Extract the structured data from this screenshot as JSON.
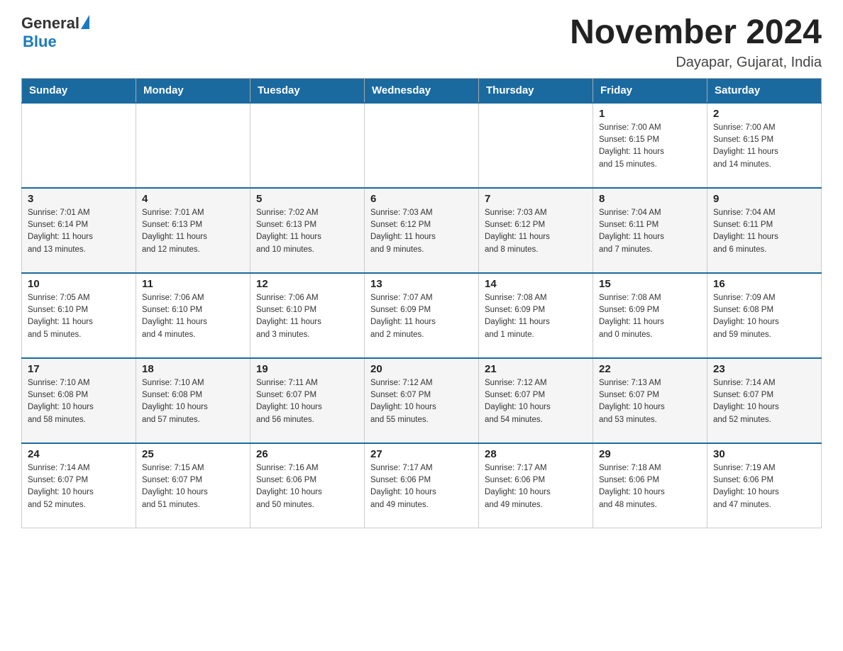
{
  "header": {
    "logo_general": "General",
    "logo_blue": "Blue",
    "month_title": "November 2024",
    "location": "Dayapar, Gujarat, India"
  },
  "weekdays": [
    "Sunday",
    "Monday",
    "Tuesday",
    "Wednesday",
    "Thursday",
    "Friday",
    "Saturday"
  ],
  "rows": [
    {
      "cells": [
        {
          "day": "",
          "info": ""
        },
        {
          "day": "",
          "info": ""
        },
        {
          "day": "",
          "info": ""
        },
        {
          "day": "",
          "info": ""
        },
        {
          "day": "",
          "info": ""
        },
        {
          "day": "1",
          "info": "Sunrise: 7:00 AM\nSunset: 6:15 PM\nDaylight: 11 hours\nand 15 minutes."
        },
        {
          "day": "2",
          "info": "Sunrise: 7:00 AM\nSunset: 6:15 PM\nDaylight: 11 hours\nand 14 minutes."
        }
      ]
    },
    {
      "cells": [
        {
          "day": "3",
          "info": "Sunrise: 7:01 AM\nSunset: 6:14 PM\nDaylight: 11 hours\nand 13 minutes."
        },
        {
          "day": "4",
          "info": "Sunrise: 7:01 AM\nSunset: 6:13 PM\nDaylight: 11 hours\nand 12 minutes."
        },
        {
          "day": "5",
          "info": "Sunrise: 7:02 AM\nSunset: 6:13 PM\nDaylight: 11 hours\nand 10 minutes."
        },
        {
          "day": "6",
          "info": "Sunrise: 7:03 AM\nSunset: 6:12 PM\nDaylight: 11 hours\nand 9 minutes."
        },
        {
          "day": "7",
          "info": "Sunrise: 7:03 AM\nSunset: 6:12 PM\nDaylight: 11 hours\nand 8 minutes."
        },
        {
          "day": "8",
          "info": "Sunrise: 7:04 AM\nSunset: 6:11 PM\nDaylight: 11 hours\nand 7 minutes."
        },
        {
          "day": "9",
          "info": "Sunrise: 7:04 AM\nSunset: 6:11 PM\nDaylight: 11 hours\nand 6 minutes."
        }
      ]
    },
    {
      "cells": [
        {
          "day": "10",
          "info": "Sunrise: 7:05 AM\nSunset: 6:10 PM\nDaylight: 11 hours\nand 5 minutes."
        },
        {
          "day": "11",
          "info": "Sunrise: 7:06 AM\nSunset: 6:10 PM\nDaylight: 11 hours\nand 4 minutes."
        },
        {
          "day": "12",
          "info": "Sunrise: 7:06 AM\nSunset: 6:10 PM\nDaylight: 11 hours\nand 3 minutes."
        },
        {
          "day": "13",
          "info": "Sunrise: 7:07 AM\nSunset: 6:09 PM\nDaylight: 11 hours\nand 2 minutes."
        },
        {
          "day": "14",
          "info": "Sunrise: 7:08 AM\nSunset: 6:09 PM\nDaylight: 11 hours\nand 1 minute."
        },
        {
          "day": "15",
          "info": "Sunrise: 7:08 AM\nSunset: 6:09 PM\nDaylight: 11 hours\nand 0 minutes."
        },
        {
          "day": "16",
          "info": "Sunrise: 7:09 AM\nSunset: 6:08 PM\nDaylight: 10 hours\nand 59 minutes."
        }
      ]
    },
    {
      "cells": [
        {
          "day": "17",
          "info": "Sunrise: 7:10 AM\nSunset: 6:08 PM\nDaylight: 10 hours\nand 58 minutes."
        },
        {
          "day": "18",
          "info": "Sunrise: 7:10 AM\nSunset: 6:08 PM\nDaylight: 10 hours\nand 57 minutes."
        },
        {
          "day": "19",
          "info": "Sunrise: 7:11 AM\nSunset: 6:07 PM\nDaylight: 10 hours\nand 56 minutes."
        },
        {
          "day": "20",
          "info": "Sunrise: 7:12 AM\nSunset: 6:07 PM\nDaylight: 10 hours\nand 55 minutes."
        },
        {
          "day": "21",
          "info": "Sunrise: 7:12 AM\nSunset: 6:07 PM\nDaylight: 10 hours\nand 54 minutes."
        },
        {
          "day": "22",
          "info": "Sunrise: 7:13 AM\nSunset: 6:07 PM\nDaylight: 10 hours\nand 53 minutes."
        },
        {
          "day": "23",
          "info": "Sunrise: 7:14 AM\nSunset: 6:07 PM\nDaylight: 10 hours\nand 52 minutes."
        }
      ]
    },
    {
      "cells": [
        {
          "day": "24",
          "info": "Sunrise: 7:14 AM\nSunset: 6:07 PM\nDaylight: 10 hours\nand 52 minutes."
        },
        {
          "day": "25",
          "info": "Sunrise: 7:15 AM\nSunset: 6:07 PM\nDaylight: 10 hours\nand 51 minutes."
        },
        {
          "day": "26",
          "info": "Sunrise: 7:16 AM\nSunset: 6:06 PM\nDaylight: 10 hours\nand 50 minutes."
        },
        {
          "day": "27",
          "info": "Sunrise: 7:17 AM\nSunset: 6:06 PM\nDaylight: 10 hours\nand 49 minutes."
        },
        {
          "day": "28",
          "info": "Sunrise: 7:17 AM\nSunset: 6:06 PM\nDaylight: 10 hours\nand 49 minutes."
        },
        {
          "day": "29",
          "info": "Sunrise: 7:18 AM\nSunset: 6:06 PM\nDaylight: 10 hours\nand 48 minutes."
        },
        {
          "day": "30",
          "info": "Sunrise: 7:19 AM\nSunset: 6:06 PM\nDaylight: 10 hours\nand 47 minutes."
        }
      ]
    }
  ]
}
